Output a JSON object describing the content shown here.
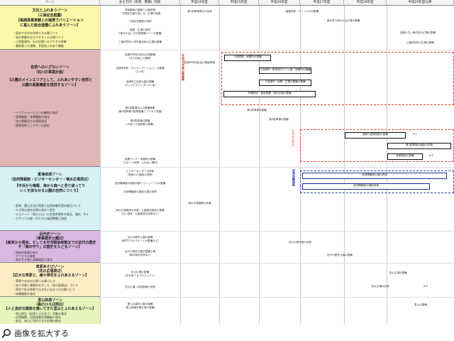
{
  "header": {
    "columns": [
      "ゾーン",
      "主な方向（改善、整備）内容",
      "平成24年度",
      "平成25年度",
      "平成26年度",
      "平成27年度",
      "平成28年度",
      "平成29年度以降"
    ]
  },
  "zones": [
    {
      "title1": "文化とふれあうゾーン",
      "title2": "（三保記念庭園）",
      "title3": "【格調高著景観との連携でバリエーション",
      "title4": "に富んだ総合遊園にふれあうゾーン】",
      "bullets": [
        "・歴史や文化を体感できる場づくり",
        "・池の景観を分かりやすくれる場づくり",
        "・三保管理所、石の広場へのアクセス改善",
        "・美術館との連携、多面的ふれあう機能"
      ]
    },
    {
      "title1": "自然へのいざないゾーン",
      "title2": "（石川の事業計画）",
      "title3": "【公園のメインエリアとして、ふれあいやすい自然と",
      "title4": "公園の基盤機能を提供するゾーン】",
      "bullets": [
        "・インフォメーションの機能の強化",
        "・管理機能、休憩機能の強化",
        "・池の景観及び水環境強化",
        "・植物園地でしずかいの創出"
      ]
    },
    {
      "title1": "夏海体感ゾーン",
      "title2": "（自然情報館・ビジターセンター・噴水広場周辺）",
      "title3": "【中浜から確報、海から森へと見り返ってり",
      "title4": "いくを体なせる公園の自然につくり】",
      "bullets": [
        "・夏海、景山文化の再東と自然体験学習の拠点づくり",
        "・人工的な旅を自然の並木へ再生",
        "・エコゾーン（海から山）の生物多様性の保全、強化　※３",
        "・デザインの統一がとれた施設整備と改修"
      ]
    },
    {
      "title1": "近代史ゾーン",
      "title2": "（軍事歴史公園辺）",
      "title3": "【真実から明治、そして太平洋戦争終戦までの近代の歴史",
      "title4": "や「海の守り」の歴史をたどるゾーン】",
      "bullets": [
        "・国府的資源の紹介",
        "・アクセスの改善",
        "・海の生き物と体験施設の強化"
      ]
    },
    {
      "title1": "草原あそびゾーン",
      "title2": "（花の広場周辺）",
      "title3": "【広大な草原と、様々草花をふれあえるゾーン】",
      "title4": "",
      "bullets": [
        "・草原でのびのび遊べる場づくり",
        "・花々が咲く表情を生かした（花の園演出）づくり",
        "・草花で彩る季節でのきれいなまつりの場づくり",
        "・体験機能の強化"
      ]
    },
    {
      "title1": "里山体感ゾーン",
      "title2": "（森のひろば周辺）",
      "title3": "【人と良好な関係を築いてきた里山とふれあえるゾーン】",
      "title4": "",
      "bullets": [
        "・里山再生（自然とふれあう）活動の強化",
        "・自然観察、自然体験学習機能の強化",
        "・安全、安心に利用できる空間の創出"
      ]
    }
  ],
  "measures": [
    {
      "zone": 0,
      "items": [
        "茶室動線の園路と公園修景",
        "「古都名石園を感じる」広場の改善",
        "三保記念庭園の改修",
        "園路・広場の改修",
        "（「新みの会」古木再整備ゾーンの整備）",
        "三保研究所と研究室活用の広場の整備"
      ]
    },
    {
      "zone": 1,
      "items": [
        "沼津市学校の防災広場整備",
        "（まち計画との連携）",
        "沼津市学校（オリエンテーション）の整備",
        "（2ヶ所）",
        "沼津市立自然公園の整備",
        "（ディスクカウンター2ヶ所）",
        "第2駐車場出入口整備事業",
        "（第5駐車場の駐車整備とアクセス改善）",
        "第4駐車場の整備",
        "（大型バス用駐車の整備）",
        "各種ベンチ・休憩所の整備",
        "（スポーツ休憩・ふれあい場所）"
      ]
    },
    {
      "zone": 2,
      "items": [
        "ビジターセンターの改修",
        "（旧館の11施設の改修）",
        "自然情報館の施設改善とリニューアルの整備",
        "自然情報館の施設の展示改修",
        "海の広場遊具の改善・公園緑化施設の整備",
        "（古い遊具・公園施設の改修など）"
      ]
    },
    {
      "zone": 3,
      "items": [
        "近代の歴史公園の整備",
        "（南門アクセスルートの整備など）",
        "近代の歴史公園の整備工事",
        "（展示館の改修など）"
      ]
    },
    {
      "zone": 4,
      "items": [
        "花の広場の整備",
        "（花を育てるプロジェクト）",
        "花の広場への駐車場の改修"
      ]
    },
    {
      "zone": 5,
      "items": [
        "里山の森林公園の整備",
        "（里山体験学習の場の整備）"
      ]
    }
  ],
  "schedule": [
    {
      "text": "第1駐車場周辺の改修",
      "col": 2
    },
    {
      "text": "園路改修・ゲート入口の整備",
      "col": 4
    },
    {
      "text": "東京湾で使われる広場の整備",
      "col": 5
    },
    {
      "text": "旧館の古い案内所の広場の整備",
      "col": 6
    },
    {
      "text": "三保研究所の広場の整備",
      "col": 6
    },
    {
      "text": "沼津市学校区及び庭園修景",
      "col": 2
    },
    {
      "text": "①駐車場・休憩所の整備",
      "col": 3
    },
    {
      "text": "②沼津市・修学旅行ゾーン館・休憩所の整備",
      "col": 4
    },
    {
      "text": "③沼津市・休憩・広場の整備の整備",
      "col": 4
    },
    {
      "text": "外構改修・施設整備・案内広場の整備",
      "col": 4
    },
    {
      "text": "第1駐車場の整備",
      "col": 3
    },
    {
      "text": "第4駐車場の整備",
      "col": 3
    },
    {
      "text": "遊具の遊具施設の整備",
      "col": 5
    },
    {
      "text": "第1駐車場の施設の改修",
      "col": 5
    },
    {
      "text": "休憩施設の整備",
      "col": 5
    },
    {
      "text": "自然情報館の展示改修",
      "col": 4
    },
    {
      "text": "自然情報館の施設改修",
      "col": 4
    },
    {
      "text": "海の広場遊具の改善",
      "col": 2
    },
    {
      "text": "近代の歴史館の改修",
      "col": 4
    },
    {
      "text": "近代の歴史公園の整備",
      "col": 5
    },
    {
      "text": "花の広場の整備",
      "col": 5
    },
    {
      "text": "花の広場の改修",
      "col": 6
    },
    {
      "text": "里山の整備",
      "col": 6
    }
  ],
  "notes": [
    "※１",
    "※２",
    "※４"
  ],
  "vertical_labels": [
    "平成30年度以降事業",
    "シェルハウス",
    "自然体験施設"
  ],
  "footer": {
    "enlarge": "画像を拡大する"
  },
  "colors": {
    "zone0": "#fdf8a8",
    "zone1": "#e0b6b6",
    "zone2": "#d6f0f6",
    "zone3": "#d9b8e2",
    "zone4": "#fbeec4",
    "zone5": "#e7f4bd",
    "dash_red": "#e23b2a",
    "dash_blue": "#2a3bb5"
  }
}
